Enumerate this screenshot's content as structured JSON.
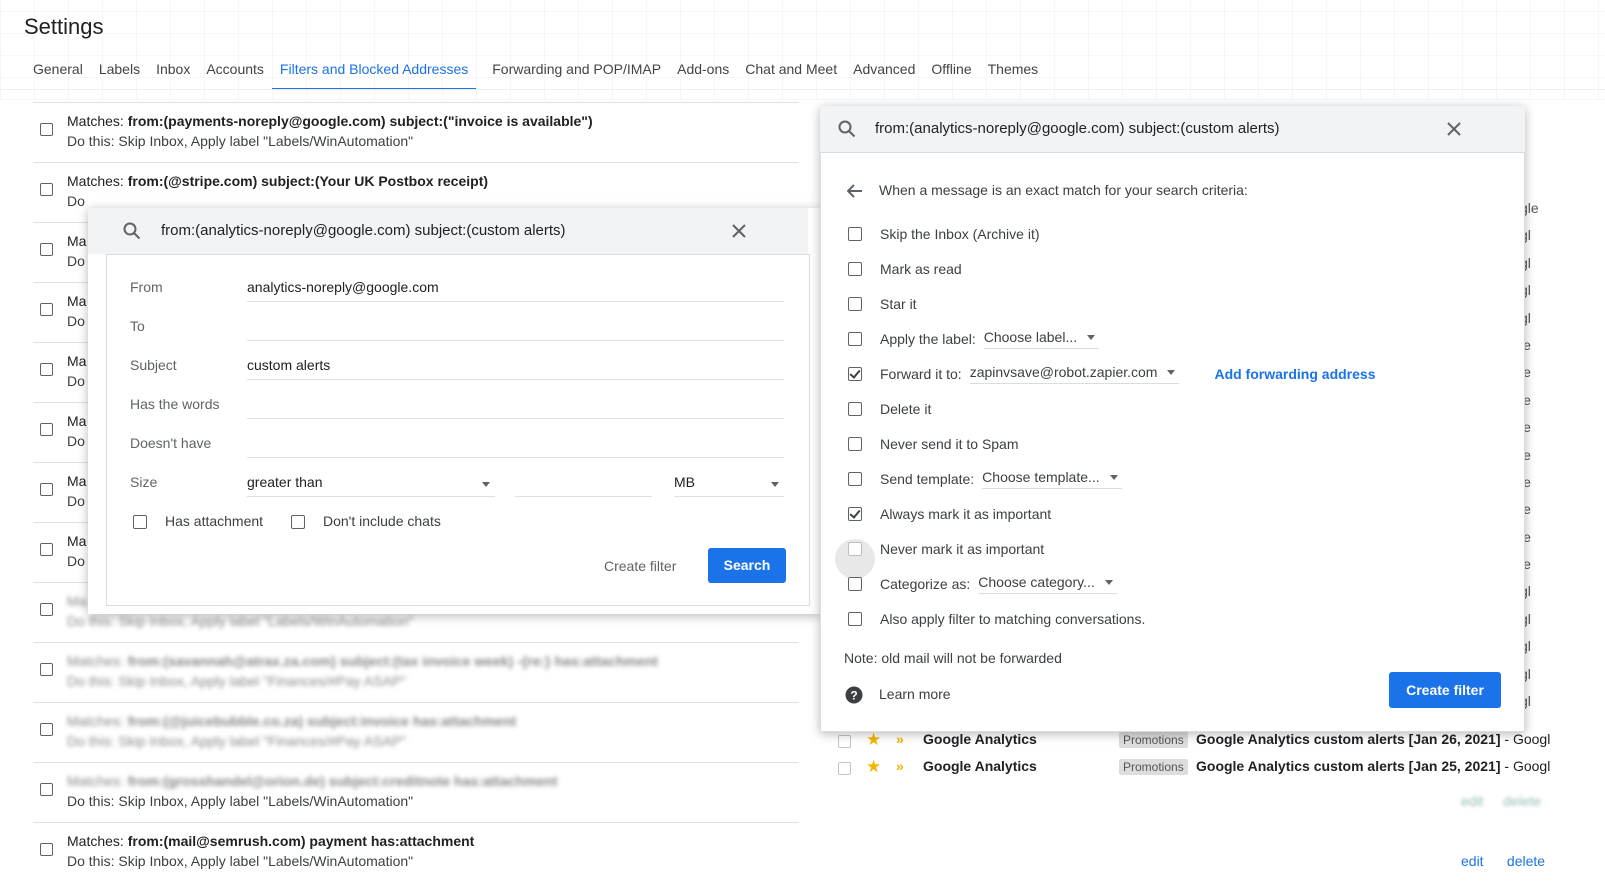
{
  "page_title": "Settings",
  "tabs": [
    "General",
    "Labels",
    "Inbox",
    "Accounts",
    "Filters and Blocked Addresses",
    "Forwarding and POP/IMAP",
    "Add-ons",
    "Chat and Meet",
    "Advanced",
    "Offline",
    "Themes"
  ],
  "filters": [
    {
      "l1_prefix": "Matches:",
      "l1_bold": "from:(payments-noreply@google.com) subject:(\"invoice is available\")",
      "l2": "Do this: Skip Inbox, Apply label \"Labels/WinAutomation\""
    },
    {
      "l1_prefix": "Matches:",
      "l1_bold": "from:(@stripe.com) subject:(Your UK Postbox receipt)",
      "l2": "Do"
    },
    {
      "l1_prefix": "Ma",
      "l1_bold": "",
      "l2": "Do"
    },
    {
      "l1_prefix": "Ma",
      "l1_bold": "",
      "l2": "Do"
    },
    {
      "l1_prefix": "Ma",
      "l1_bold": "",
      "l2": "Do"
    },
    {
      "l1_prefix": "Ma",
      "l1_bold": "",
      "l2": "Do"
    },
    {
      "l1_prefix": "Ma",
      "l1_bold": "",
      "l2": "Do"
    },
    {
      "l1_prefix": "Ma",
      "l1_bold": "",
      "l2": "Do"
    },
    {
      "l1_prefix": "Ma",
      "l1_bold": "",
      "l2": "Do this: Skip Inbox, Apply label \"Labels/WinAutomation\""
    },
    {
      "l1_prefix": "Matches:",
      "l1_bold": "from:(savannah@atrax.za.com) subject:(tax invoice week) -{re:} has:attachment",
      "l2": "Do this: Skip Inbox, Apply label \"Finances/#Pay ASAP\""
    },
    {
      "l1_prefix": "Matches:",
      "l1_bold": "from:(@juicebubble.co.za) subject:invoice has:attachment",
      "l2": "Do this: Skip Inbox, Apply label \"Finances/#Pay ASAP\""
    },
    {
      "l1_prefix": "Matches:",
      "l1_bold": "from:(grosshandel@orion.de) subject:creditnote has:attachment",
      "l2": "Do this: Skip Inbox, Apply label \"Labels/WinAutomation\""
    },
    {
      "l1_prefix": "Matches:",
      "l1_bold": "from:(mail@semrush.com) payment has:attachment",
      "l2": "Do this: Skip Inbox, Apply label \"Labels/WinAutomation\""
    }
  ],
  "row_actions": {
    "edit": "edit",
    "delete": "delete",
    "edit_blur": "edit",
    "delete_blur": "delete"
  },
  "bg_right": [
    "gle",
    "gl",
    "gl",
    "gl",
    "gl",
    "le",
    "le",
    "le",
    "le",
    "le",
    "le",
    "le",
    "le",
    "le",
    "gl",
    "gl",
    "gl",
    "gl",
    "gl"
  ],
  "search_dialog": {
    "query": "from:(analytics-noreply@google.com) subject:(custom alerts)",
    "from_label": "From",
    "from_value": "analytics-noreply@google.com",
    "to_label": "To",
    "to_value": "",
    "subject_label": "Subject",
    "subject_value": "custom alerts",
    "has_words_label": "Has the words",
    "has_words_value": "",
    "doesnt_have_label": "Doesn't have",
    "doesnt_have_value": "",
    "size_label": "Size",
    "size_op": "greater than",
    "size_unit": "MB",
    "has_attachment": "Has attachment",
    "dont_include_chats": "Don't include chats",
    "create_filter": "Create filter",
    "search": "Search"
  },
  "filter_dialog": {
    "query": "from:(analytics-noreply@google.com) subject:(custom alerts)",
    "header": "When a message is an exact match for your search criteria:",
    "options": {
      "skip_inbox": "Skip the Inbox (Archive it)",
      "mark_read": "Mark as read",
      "star": "Star it",
      "apply_label": "Apply the label:",
      "apply_label_value": "Choose label...",
      "forward": "Forward it to:",
      "forward_value": "zapinvsave@robot.zapier.com",
      "add_forwarding": "Add forwarding address",
      "delete": "Delete it",
      "never_spam": "Never send it to Spam",
      "send_template": "Send template:",
      "send_template_value": "Choose template...",
      "always_important": "Always mark it as important",
      "never_important": "Never mark it as important",
      "categorize": "Categorize as:",
      "categorize_value": "Choose category...",
      "also_apply": "Also apply filter to matching conversations."
    },
    "note": "Note: old mail will not be forwarded",
    "learn_more": "Learn more",
    "create_filter": "Create filter"
  },
  "mails": [
    {
      "sender": "Google Analytics",
      "tag": "Promotions",
      "subject": "Google Analytics custom alerts [Jan 26, 2021]",
      "snippet": " - Googl"
    },
    {
      "sender": "Google Analytics",
      "tag": "Promotions",
      "subject": "Google Analytics custom alerts [Jan 25, 2021]",
      "snippet": " - Googl"
    }
  ],
  "colors": {
    "accent": "#1a73e8",
    "star": "#f4b400"
  }
}
